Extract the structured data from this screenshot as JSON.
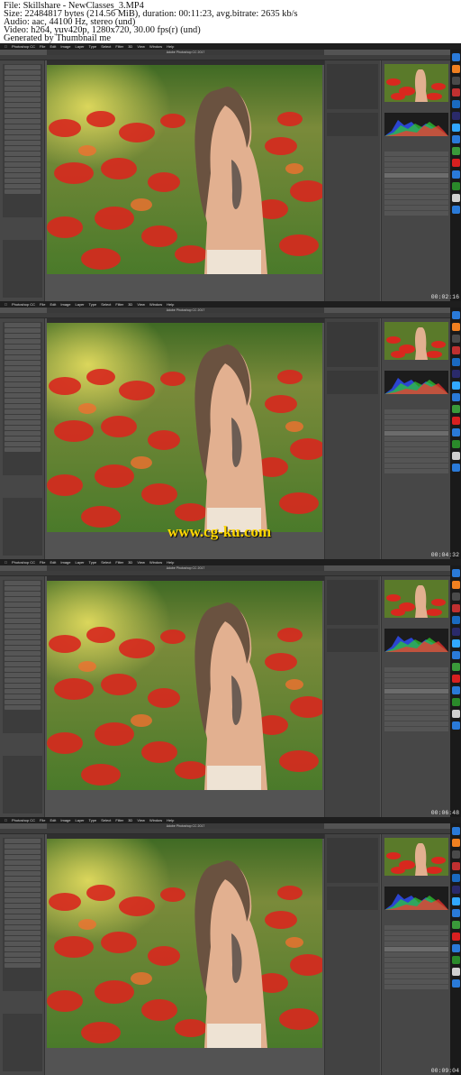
{
  "header": {
    "file": "File: Skillshare - NewClasses_3.MP4",
    "size": "Size: 22484817 bytes (214.56 MiB), duration: 00:11:23, avg.bitrate: 2635 kb/s",
    "audio": "Audio: aac, 44100 Hz, stereo (und)",
    "video": "Video: h264, yuv420p, 1280x720, 30.00 fps(r) (und)",
    "generated": "Generated by Thumbnail me"
  },
  "app": {
    "name": "Photoshop CC",
    "menus": [
      "File",
      "Edit",
      "Image",
      "Layer",
      "Type",
      "Select",
      "Filter",
      "3D",
      "View",
      "Window",
      "Help"
    ],
    "doc_title": "Adobe Photoshop CC 2017",
    "doc_tab": "0011 - Girl-Red-Grass.jpg @ 50% (Levels 1, RGB/8) *"
  },
  "frames": [
    {
      "timestamp": "00:02:16"
    },
    {
      "timestamp": "00:04:32"
    },
    {
      "timestamp": "00:06:48"
    },
    {
      "timestamp": "00:09:04"
    }
  ],
  "watermark": "www.cg-ku.com",
  "colors": {
    "ui_bg": "#535353",
    "panel": "#474747",
    "dark": "#1e1e1e",
    "watermark": "#ffd700"
  }
}
